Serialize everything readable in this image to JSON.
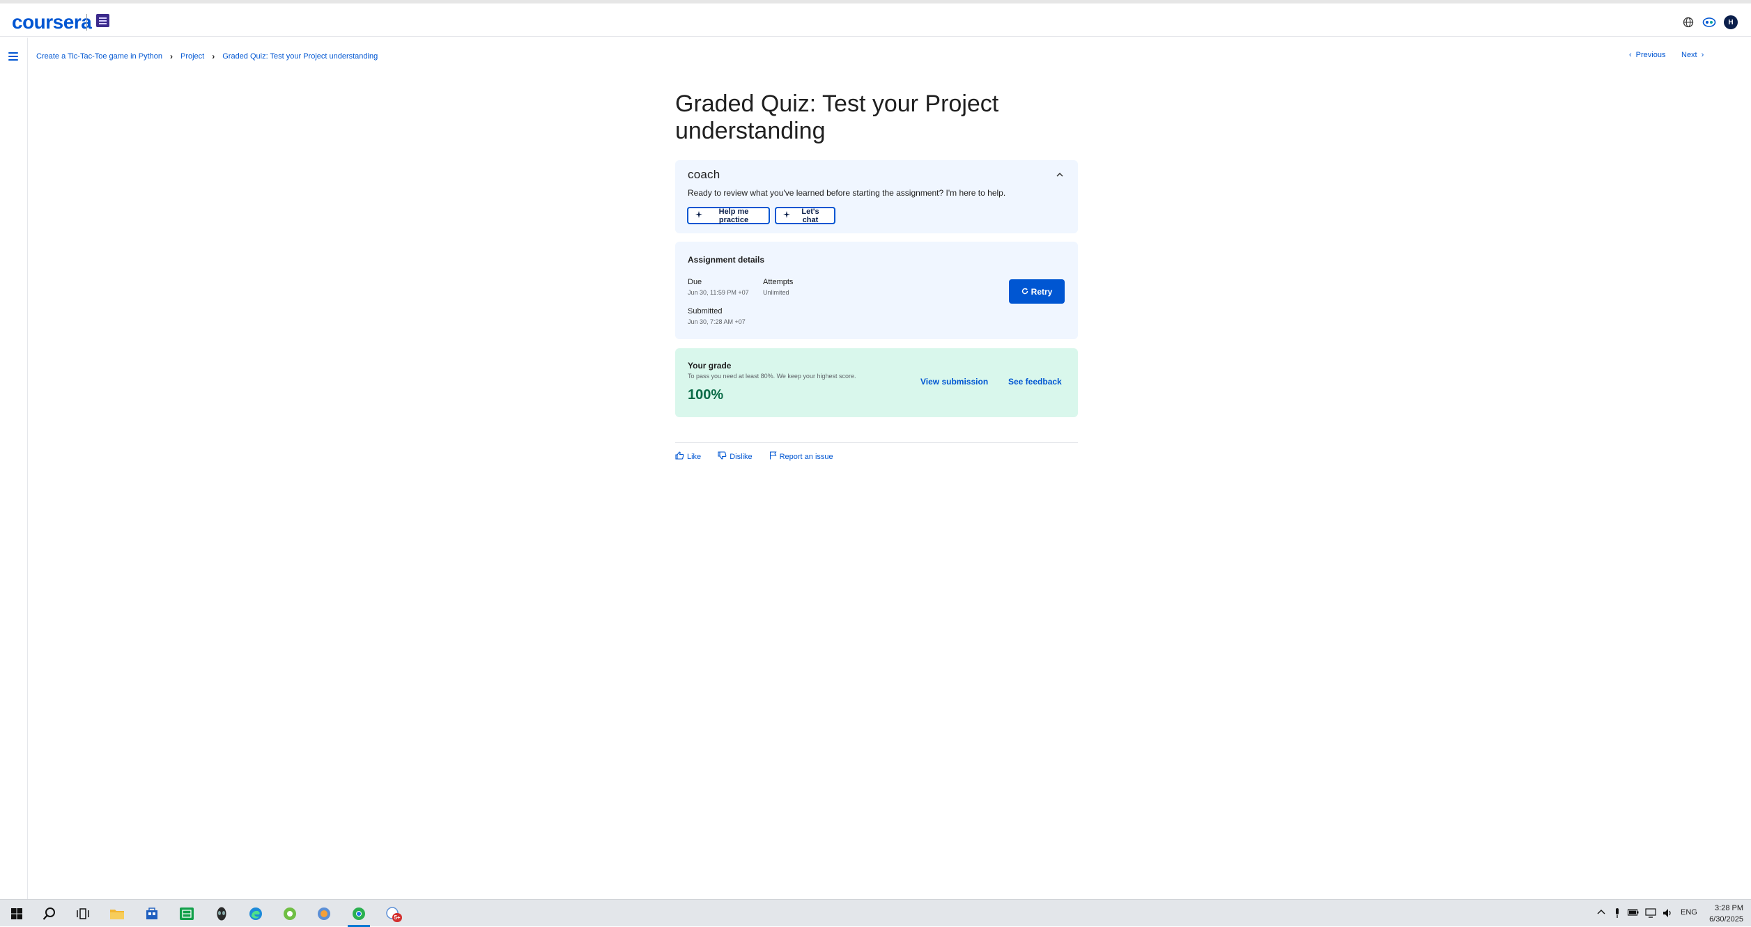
{
  "header": {
    "logo_text": "coursera",
    "avatar_initial": "H"
  },
  "breadcrumb": {
    "items": [
      "Create a Tic-Tac-Toe game in Python",
      "Project",
      "Graded Quiz: Test your Project understanding"
    ]
  },
  "nav": {
    "previous_label": "Previous",
    "next_label": "Next"
  },
  "page": {
    "title": "Graded Quiz: Test your Project understanding"
  },
  "coach": {
    "title": "coach",
    "message": "Ready to review what you've learned before starting the assignment? I'm here to help.",
    "practice_label": "Help me practice",
    "chat_label": "Let's chat"
  },
  "assignment": {
    "title": "Assignment details",
    "due_label": "Due",
    "due_value": "Jun 30, 11:59 PM +07",
    "attempts_label": "Attempts",
    "attempts_value": "Unlimited",
    "submitted_label": "Submitted",
    "submitted_value": "Jun 30, 7:28 AM +07",
    "retry_label": "Retry"
  },
  "grade": {
    "title": "Your grade",
    "hint": "To pass you need at least 80%. We keep your highest score.",
    "value": "100%",
    "view_submission_label": "View submission",
    "see_feedback_label": "See feedback"
  },
  "feedback": {
    "like_label": "Like",
    "dislike_label": "Dislike",
    "report_label": "Report an issue"
  },
  "taskbar": {
    "language": "ENG",
    "time": "3:28 PM",
    "date": "6/30/2025",
    "badge": "5+"
  },
  "colors": {
    "brand": "#0056d2",
    "grade_bg": "#d9f7ec",
    "card_bg": "#f0f6ff"
  }
}
